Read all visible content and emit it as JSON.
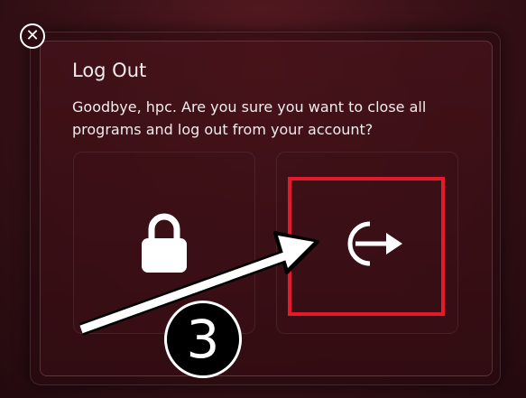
{
  "dialog": {
    "title": "Log Out",
    "message": "Goodbye, hpc. Are you sure you want to close all programs and log out from your account?",
    "close_icon": "close-icon",
    "options": [
      {
        "icon": "lock-icon"
      },
      {
        "icon": "logout-icon"
      }
    ]
  },
  "annotation": {
    "step_number": "3",
    "highlight_color": "#e3192c",
    "arrow_color": "#ffffff"
  }
}
